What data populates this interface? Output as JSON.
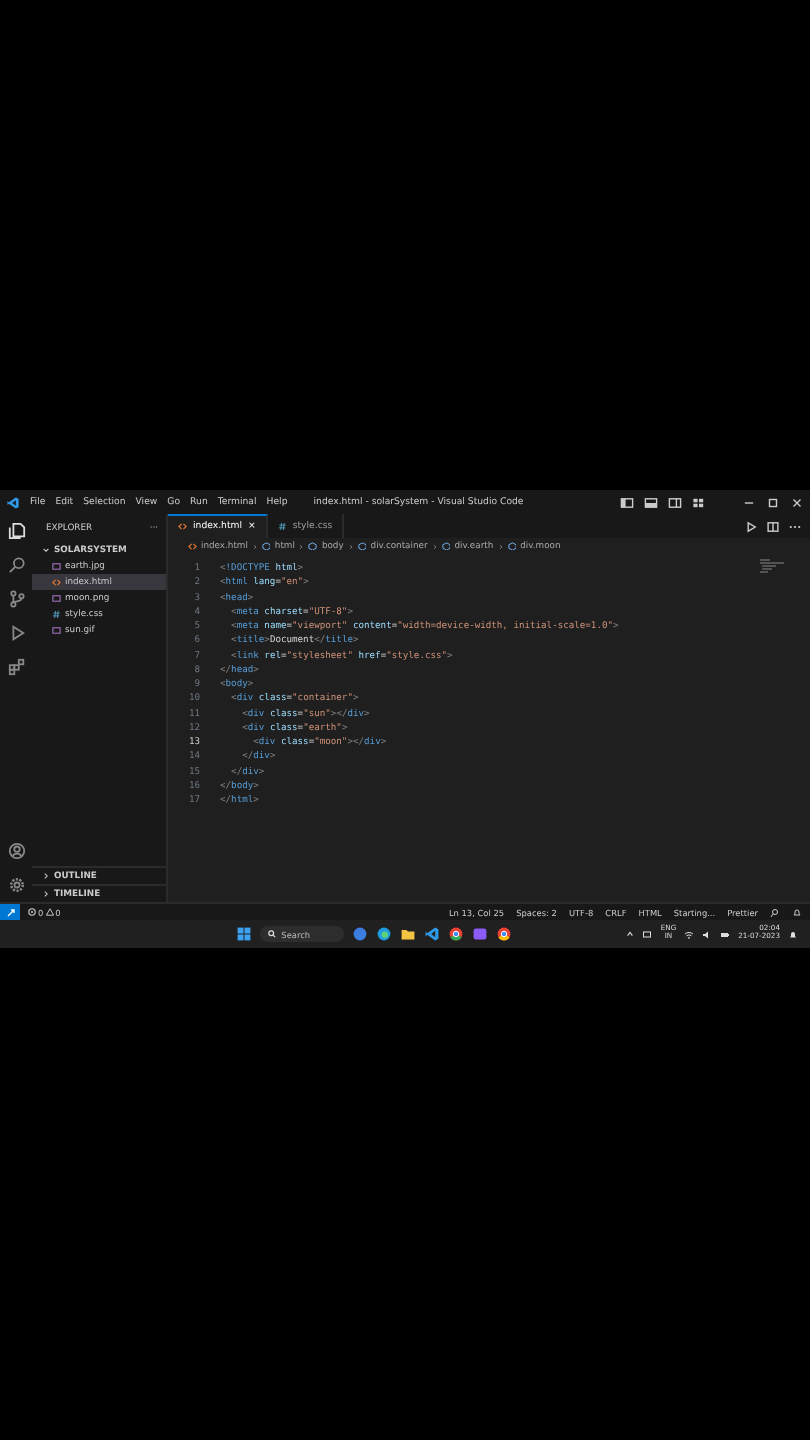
{
  "window": {
    "title": "index.html - solarSystem - Visual Studio Code"
  },
  "menu": [
    "File",
    "Edit",
    "Selection",
    "View",
    "Go",
    "Run",
    "Terminal",
    "Help"
  ],
  "sidebar": {
    "title": "EXPLORER",
    "more": "···",
    "folder": {
      "name": "SOLARSYSTEM",
      "expanded": true
    },
    "files": [
      {
        "name": "earth.jpg",
        "kind": "image",
        "selected": false
      },
      {
        "name": "index.html",
        "kind": "html",
        "selected": true
      },
      {
        "name": "moon.png",
        "kind": "image",
        "selected": false
      },
      {
        "name": "style.css",
        "kind": "css",
        "selected": false
      },
      {
        "name": "sun.gif",
        "kind": "image",
        "selected": false
      }
    ],
    "sections": [
      {
        "name": "OUTLINE",
        "expanded": false
      },
      {
        "name": "TIMELINE",
        "expanded": false
      }
    ]
  },
  "tabs": [
    {
      "label": "index.html",
      "kind": "html",
      "selected": true,
      "close": "×"
    },
    {
      "label": "style.css",
      "kind": "css",
      "selected": false
    }
  ],
  "breadcrumb": [
    {
      "label": "index.html",
      "kind": "html"
    },
    {
      "label": "html",
      "kind": "element"
    },
    {
      "label": "body",
      "kind": "element"
    },
    {
      "label": "div.container",
      "kind": "element"
    },
    {
      "label": "div.earth",
      "kind": "element"
    },
    {
      "label": "div.moon",
      "kind": "element"
    }
  ],
  "code": {
    "lines": [
      {
        "n": "1",
        "text": "<!DOCTYPE html>",
        "current": false
      },
      {
        "n": "2",
        "text": "<html lang=\"en\">",
        "current": false
      },
      {
        "n": "3",
        "text": "<head>",
        "current": false
      },
      {
        "n": "4",
        "text": "  <meta charset=\"UTF-8\">",
        "current": false
      },
      {
        "n": "5",
        "text": "  <meta name=\"viewport\" content=\"width=device-width, initial-scale=1.0\">",
        "current": false
      },
      {
        "n": "6",
        "text": "  <title>Document</title>",
        "current": false
      },
      {
        "n": "7",
        "text": "  <link rel=\"stylesheet\" href=\"style.css\">",
        "current": false
      },
      {
        "n": "8",
        "text": "</head>",
        "current": false
      },
      {
        "n": "9",
        "text": "<body>",
        "current": false
      },
      {
        "n": "10",
        "text": "  <div class=\"container\">",
        "current": false
      },
      {
        "n": "11",
        "text": "    <div class=\"sun\"></div>",
        "current": false
      },
      {
        "n": "12",
        "text": "    <div class=\"earth\">",
        "current": false
      },
      {
        "n": "13",
        "text": "      <div class=\"moon\"></div>",
        "current": true
      },
      {
        "n": "14",
        "text": "    </div>",
        "current": false
      },
      {
        "n": "15",
        "text": "  </div>",
        "current": false
      },
      {
        "n": "16",
        "text": "</body>",
        "current": false
      },
      {
        "n": "17",
        "text": "</html>",
        "current": false
      }
    ]
  },
  "status_bar": {
    "errors": "0",
    "warnings": "0",
    "items": [
      "Ln 13, Col 25",
      "Spaces: 2",
      "UTF-8",
      "CRLF",
      "HTML",
      "Starting...",
      "Prettier"
    ]
  },
  "taskbar": {
    "search": "Search",
    "language": "ENG",
    "region": "IN",
    "time": "02:04",
    "date": "21-07-2023"
  }
}
